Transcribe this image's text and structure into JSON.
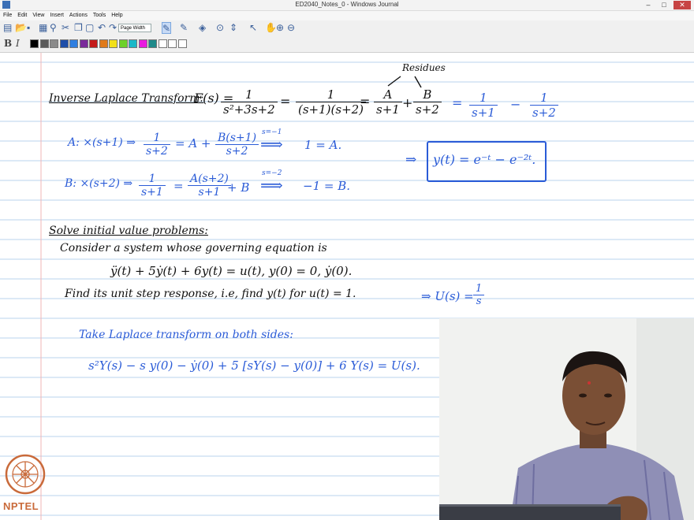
{
  "window": {
    "title": "ED2040_Notes_0 - Windows Journal",
    "minimize": "–",
    "maximize": "□",
    "close": "✕"
  },
  "menu": [
    "File",
    "Edit",
    "View",
    "Insert",
    "Actions",
    "Tools",
    "Help"
  ],
  "toolbar": {
    "page_width": "Page Width",
    "bold": "B",
    "italic": "I"
  },
  "colors": {
    "ink_black": "#111111",
    "ink_blue": "#2a5bd7",
    "rule_line": "#b9d3ee",
    "margin_line": "#f2b5b5"
  },
  "swatches": [
    "#000000",
    "#5a5a5a",
    "#8a8a8a",
    "#1f4ea8",
    "#2f7fe0",
    "#7a2a9a",
    "#c41a1a",
    "#e07a1a",
    "#f2e01a",
    "#6dd12a",
    "#1ab8c8",
    "#e91ae0",
    "#1f8a8a",
    "#ffffff",
    "#ffffff",
    "#ffffff"
  ],
  "notes": {
    "residues": "Residues",
    "ilt_heading": "Inverse Laplace Transform:",
    "F_s": "F(s) =",
    "eq1": "=",
    "eq2": "=",
    "eq3": "=",
    "minus": "−",
    "plus": "+",
    "fracs": {
      "f1": {
        "num": "1",
        "den": "s²+3s+2"
      },
      "f2": {
        "num": "1",
        "den": "(s+1)(s+2)"
      },
      "f3": {
        "num": "A",
        "den": "s+1"
      },
      "f4": {
        "num": "B",
        "den": "s+2"
      },
      "f5": {
        "num": "1",
        "den": "s+1"
      },
      "f6": {
        "num": "1",
        "den": "s+2"
      }
    },
    "lineA": {
      "label": "A: ×(s+1) ⇒",
      "f1": {
        "num": "1",
        "den": "s+2"
      },
      "mid": "= A +",
      "f2": {
        "num": "B(s+1)",
        "den": "s+2"
      },
      "sub": "s=−1",
      "arrow": "⟹",
      "res": "1 = A."
    },
    "lineB": {
      "label": "B: ×(s+2) ⇒",
      "f1": {
        "num": "1",
        "den": "s+1"
      },
      "mid": "=",
      "f2": {
        "num": "A(s+2)",
        "den": "s+1"
      },
      "mid2": "+ B",
      "sub": "s=−2",
      "arrow": "⟹",
      "res": "−1 = B."
    },
    "boxed_arrow": "⇒",
    "boxed": "y(t) = e⁻ᵗ − e⁻²ᵗ.",
    "solve_heading": "Solve initial value problems:",
    "consider": "Consider a system whose governing equation is",
    "ode": "ÿ(t) + 5ẏ(t) + 6y(t) = u(t),   y(0) = 0,  ẏ(0).",
    "find": "Find its unit step response, i.e, find y(t) for u(t) = 1.",
    "U_s": "⇒ U(s) =",
    "U_frac": {
      "num": "1",
      "den": "s"
    },
    "take": "Take Laplace transform on both sides:",
    "laplace_eq": "s²Y(s) − s y(0) − ẏ(0) + 5 [sY(s) − y(0)] + 6 Y(s) = U(s)."
  },
  "logo": {
    "text": "NPTEL"
  }
}
